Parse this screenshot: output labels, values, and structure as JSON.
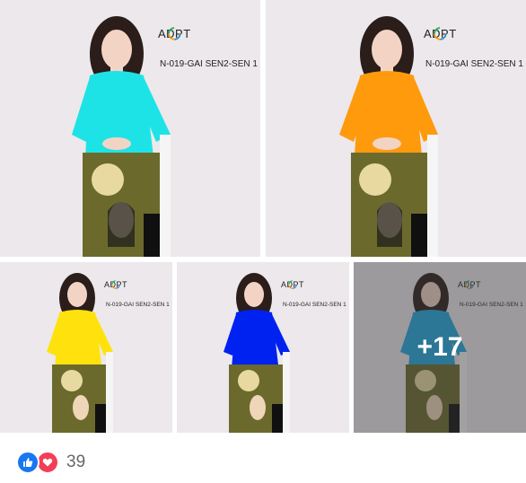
{
  "brand_name": "ADPT",
  "product_code": "N-019-GAI SEN2-SEN 1",
  "photos": [
    {
      "dress_color": "#1ee3e6"
    },
    {
      "dress_color": "#ff9a0d"
    },
    {
      "dress_color": "#ffe20d"
    },
    {
      "dress_color": "#0022f0"
    },
    {
      "dress_color": "#1fa7e0"
    }
  ],
  "more_overlay": "+17",
  "reactions": {
    "icons": [
      "like-icon",
      "love-icon"
    ],
    "count": "39",
    "like_color": "#1877f2",
    "love_color": "#f33e58"
  }
}
